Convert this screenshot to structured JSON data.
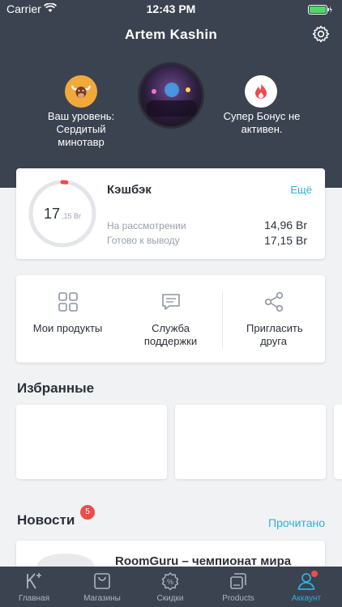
{
  "status_bar": {
    "carrier": "Carrier",
    "time": "12:43 PM"
  },
  "profile": {
    "name": "Artem Kashin",
    "level_text": "Ваш уровень: Сердитый минотавр",
    "bonus_text": "Супер Бонус не активен."
  },
  "cashback": {
    "title": "Кэшбэк",
    "more": "Ещё",
    "ring_value": "17",
    "ring_fraction": ",15 Br",
    "ring_progress": 0.02,
    "rows": [
      {
        "label": "На рассмотрении",
        "value": "14,96 Br"
      },
      {
        "label": "Готово к выводу",
        "value": "17,15 Br"
      }
    ]
  },
  "actions": [
    {
      "label": "Мои продукты",
      "icon": "grid-icon"
    },
    {
      "label": "Служба поддержки",
      "icon": "chat-icon"
    },
    {
      "label": "Пригласить друга",
      "icon": "share-icon"
    }
  ],
  "favorites": {
    "title": "Избранные"
  },
  "news": {
    "title": "Новости",
    "count": "5",
    "read_label": "Прочитано",
    "item_title": "RoomGuru – чемпионат мира"
  },
  "tabs": [
    {
      "label": "Главная",
      "icon": "home-k-icon"
    },
    {
      "label": "Магазины",
      "icon": "bag-icon"
    },
    {
      "label": "Скидки",
      "icon": "discount-icon"
    },
    {
      "label": "Products",
      "icon": "products-icon"
    },
    {
      "label": "Аккаунт",
      "icon": "account-icon"
    }
  ],
  "colors": {
    "header": "#3b4350",
    "accent": "#2db0d8",
    "badge": "#ef4b4b",
    "level": "#f2a93b"
  }
}
